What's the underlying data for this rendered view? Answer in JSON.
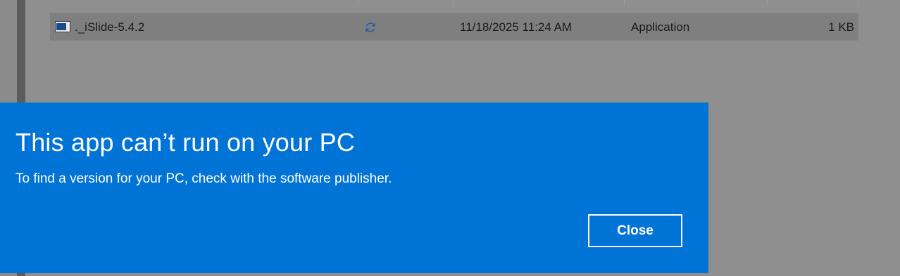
{
  "file_list": {
    "rows": [
      {
        "name": "._iSlide-5.4.2",
        "status_icon": "sync-icon",
        "date_modified": "11/18/2025 11:24 AM",
        "type": "Application",
        "size": "1 KB"
      }
    ]
  },
  "dialog": {
    "title": "This app can’t run on your PC",
    "message": "To find a version for your PC, check with the software publisher.",
    "close_label": "Close"
  },
  "colors": {
    "dialog_background": "#0073d6",
    "overlay_background": "#8f8f8f",
    "selected_row": "#7f7f7f",
    "sync_icon": "#1f5fa8"
  }
}
